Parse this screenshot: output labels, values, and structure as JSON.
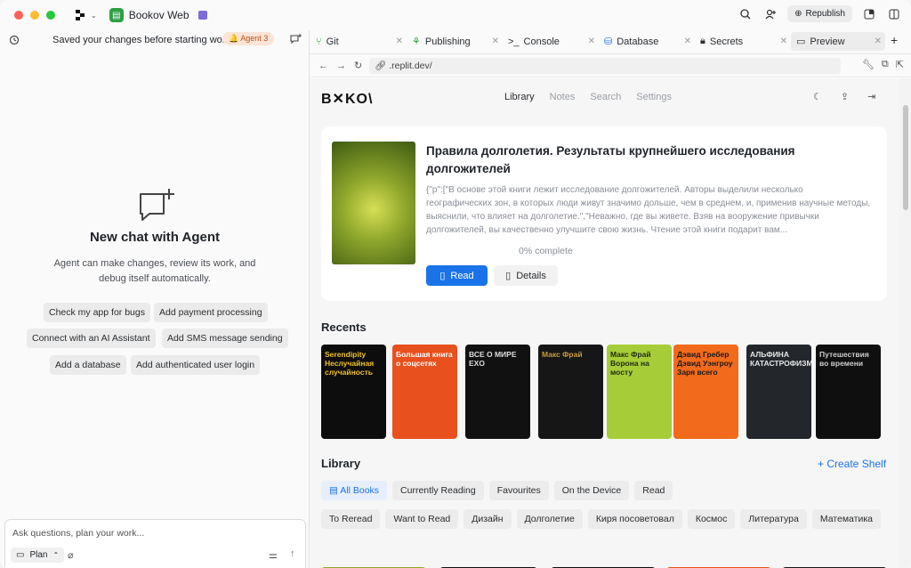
{
  "titlebar": {
    "repl_name": "Bookov Web",
    "republish_label": "Republish"
  },
  "agent": {
    "saved_message": "Saved your changes before starting work",
    "agent_badge": "Agent 3",
    "empty_title": "New chat with Agent",
    "empty_desc": "Agent can make changes, review its work, and debug itself automatically.",
    "suggestions": [
      "Check my app for bugs",
      "Add payment processing",
      "Connect with an AI Assistant",
      "Add SMS message sending",
      "Add a database",
      "Add authenticated user login"
    ],
    "input_placeholder": "Ask questions, plan your work...",
    "plan_label": "Plan"
  },
  "tabs": [
    {
      "label": "Git",
      "icon": "git-icon"
    },
    {
      "label": "Publishing",
      "icon": "publishing-icon"
    },
    {
      "label": "Console",
      "icon": "console-icon"
    },
    {
      "label": "Database",
      "icon": "database-icon"
    },
    {
      "label": "Secrets",
      "icon": "lock-icon"
    },
    {
      "label": "Preview",
      "icon": "monitor-icon"
    }
  ],
  "preview": {
    "url": ".replit.dev/"
  },
  "site": {
    "brand": "B✕KO\\",
    "nav": [
      "Library",
      "Notes",
      "Search",
      "Settings"
    ],
    "hero": {
      "title": "Правила долголетия. Результаты крупнейшего исследования долгожителей",
      "description": "{\"p\":[\"В основе этой книги лежит исследование долгожителей. Авторы выделили несколько географических зон, в которых люди живут значимо дольше, чем в среднем, и, применив научные методы, выяснили, что влияет на долголетие.\",\"Неважно, где вы живете. Взяв на вооружение привычки долгожителей, вы качественно улучшите свою жизнь. Чтение этой книги подарит вам...",
      "progress": "0% complete",
      "read_label": "Read",
      "details_label": "Details"
    },
    "recents_title": "Recents",
    "recent_books": [
      {
        "title": "Serendipity Неслучайная случайность",
        "color": "#0d0d0d",
        "text_color": "#f0c020"
      },
      {
        "title": "Большая книга о соцсетях",
        "color": "#e8501e",
        "text_color": "#ffffff"
      },
      {
        "title": "ВСЕ О МИРЕ EXO",
        "color": "#111111",
        "text_color": "#dddddd"
      },
      {
        "title": "Макс Фрай",
        "color": "#161616",
        "text_color": "#c79b3c"
      },
      {
        "title": "Макс Фрай Ворона на мосту",
        "color": "#a6cd38",
        "text_color": "#1f2a10"
      },
      {
        "title": "Дэвид Гребер Дэвид Уэнгроу Заря всего",
        "color": "#f26a1b",
        "text_color": "#1a1a1a"
      },
      {
        "title": "АЛЬФИНА КАТАСТРОФИЗМ",
        "color": "#23272c",
        "text_color": "#e6e6e6"
      },
      {
        "title": "Путешествия во времени",
        "color": "#0f0f0f",
        "text_color": "#cccccc"
      }
    ],
    "library_title": "Library",
    "create_shelf": "+ Create Shelf",
    "filters_row1": [
      "All Books",
      "Currently Reading",
      "Favourites",
      "On the Device",
      "Read"
    ],
    "filters_row2": [
      "To Reread",
      "Want to Read",
      "Дизайн",
      "Долголетие",
      "Киря посоветовал",
      "Космос",
      "Литература",
      "Математика"
    ]
  }
}
